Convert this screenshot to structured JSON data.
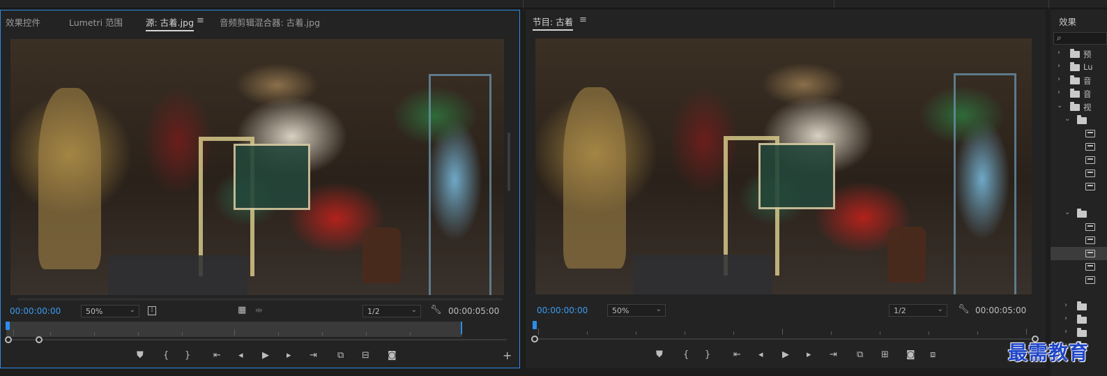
{
  "source_panel": {
    "tabs": [
      {
        "label": "效果控件"
      },
      {
        "label": "Lumetri 范围"
      },
      {
        "label": "源: 古着.jpg"
      },
      {
        "label": "音频剪辑混合器: 古着.jpg"
      }
    ],
    "timecode_current": "00:00:00:00",
    "zoom": "50%",
    "resolution": "1/2",
    "timecode_duration": "00:00:05:00"
  },
  "program_panel": {
    "title": "节目: 古着",
    "timecode_current": "00:00:00:00",
    "zoom": "50%",
    "resolution": "1/2",
    "timecode_duration": "00:00:05:00"
  },
  "effects_panel": {
    "title": "效果",
    "tree": [
      {
        "label": "预",
        "indent": 0,
        "icon": "folder-star"
      },
      {
        "label": "Lu",
        "indent": 0,
        "icon": "folder-star"
      },
      {
        "label": "音",
        "indent": 0,
        "icon": "folder"
      },
      {
        "label": "音",
        "indent": 0,
        "icon": "folder"
      },
      {
        "label": "视",
        "indent": 0,
        "icon": "folder",
        "expanded": true
      }
    ]
  },
  "icons": {
    "menu": "hamburger-icon",
    "wrench": "wrench-icon",
    "play": "play-icon",
    "camera": "camera-icon",
    "search": "search-icon"
  },
  "watermark": "最需教育",
  "colors": {
    "accent_blue": "#2d8ceb",
    "timecode_blue": "#3a9bf0",
    "panel_bg": "#232323"
  }
}
